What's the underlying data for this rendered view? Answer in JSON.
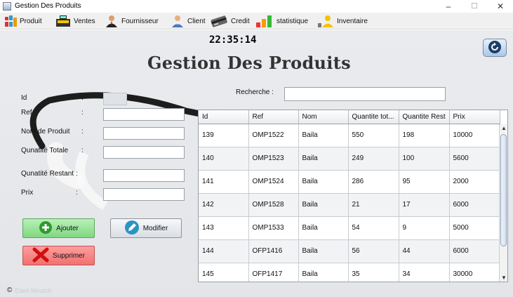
{
  "window": {
    "title": "Gestion Des Produits",
    "controls": [
      "–",
      "☐",
      "✕"
    ]
  },
  "menu": [
    {
      "label": "Produit",
      "icon": "books-icon"
    },
    {
      "label": "Ventes",
      "icon": "cash-register-icon"
    },
    {
      "label": "Fournisseur",
      "icon": "businessman-icon"
    },
    {
      "label": "Client",
      "icon": "user-icon"
    },
    {
      "label": "Credit",
      "icon": "credit-card-icon"
    },
    {
      "label": "statistique",
      "icon": "bar-chart-icon"
    },
    {
      "label": "Inventaire",
      "icon": "inventory-user-icon"
    }
  ],
  "clock": "22:35:14",
  "page_title": "Gestion Des Produits",
  "form": {
    "id_label": "Id",
    "ref_label": "Ref",
    "nom_label": "Nom de Produit",
    "qte_totale_label": "Qunatité Totale",
    "qte_restant_label": "Qunatité Restant",
    "prix_label": "Prix",
    "colon": ":",
    "id_value": "",
    "ref_value": "",
    "nom_value": "",
    "qte_totale_value": "",
    "qte_restant_value": "",
    "prix_value": ""
  },
  "search": {
    "label": "Recherche  :",
    "value": ""
  },
  "buttons": {
    "add": "Ajouter",
    "modify": "Modifier",
    "delete": "Supprimer"
  },
  "table": {
    "columns": [
      "Id",
      "Ref",
      "Nom",
      "Quantite tot...",
      "Quantite Rest",
      "Prix"
    ],
    "rows": [
      [
        "139",
        "OMP1522",
        "Baila",
        "550",
        "198",
        "10000"
      ],
      [
        "140",
        "OMP1523",
        "Baila",
        "249",
        "100",
        "5600"
      ],
      [
        "141",
        "OMP1524",
        "Baila",
        "286",
        "95",
        "2000"
      ],
      [
        "142",
        "OMP1528",
        "Baila",
        "21",
        "17",
        "6000"
      ],
      [
        "143",
        "OMP1533",
        "Baila",
        "54",
        "9",
        "5000"
      ],
      [
        "144",
        "OFP1416",
        "Baila",
        "56",
        "44",
        "6000"
      ],
      [
        "145",
        "OFP1417",
        "Baila",
        "35",
        "34",
        "30000"
      ]
    ]
  },
  "footer": {
    "copyright": "©",
    "author": "Elani Moutch"
  },
  "colors": {
    "add": "#8fe08f",
    "delete": "#f28080",
    "accent": "#3a7bd5"
  }
}
